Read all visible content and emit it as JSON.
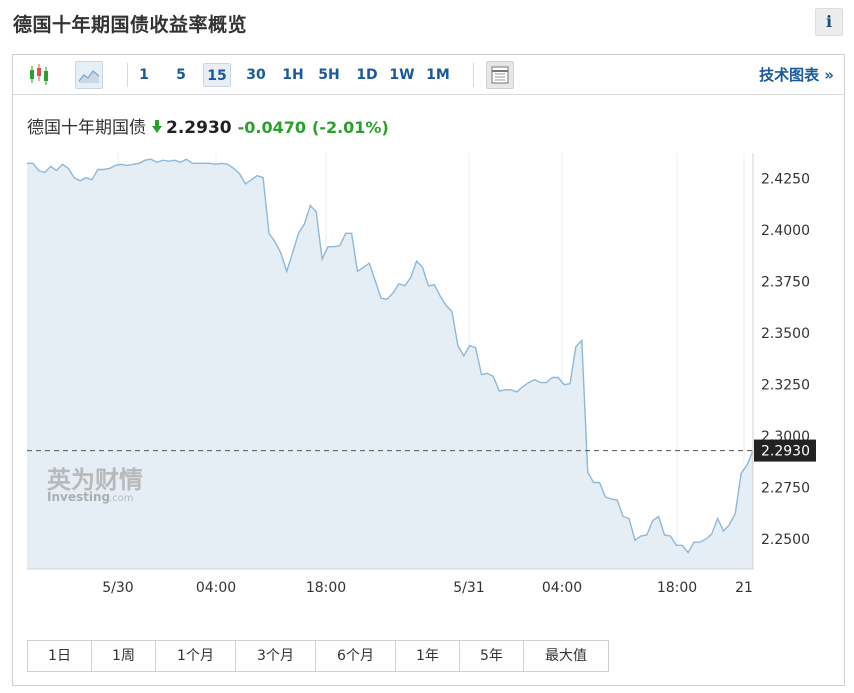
{
  "header": {
    "title": "德国十年期国债收益率概览",
    "info_label": "i"
  },
  "toolbar": {
    "intervals": [
      "1",
      "5",
      "15",
      "30",
      "1H",
      "5H",
      "1D",
      "1W",
      "1M"
    ],
    "active_interval": "15",
    "tech_link": "技术图表 »"
  },
  "quote": {
    "name": "德国十年期国债",
    "price": "2.2930",
    "change": "-0.0470",
    "change_pct": "(-2.01%)"
  },
  "watermark": {
    "cn": "英为财情",
    "en": "Investing",
    "suffix": ".com"
  },
  "ranges": [
    "1日",
    "1周",
    "1个月",
    "3个月",
    "6个月",
    "1年",
    "5年",
    "最大值"
  ],
  "colors": {
    "line": "#8fb8d8",
    "fill": "#e5eef5",
    "price_tag": "#222222",
    "change": "#2aa12a",
    "link": "#1a5a9c"
  },
  "chart_data": {
    "type": "area",
    "current_value": 2.293,
    "current_label": "2.2930",
    "ylim": [
      2.2355,
      2.4375
    ],
    "y_ticks": [
      2.425,
      2.4,
      2.375,
      2.35,
      2.325,
      2.3,
      2.275,
      2.25
    ],
    "y_tick_labels": [
      "2.4250",
      "2.4000",
      "2.3750",
      "2.3500",
      "2.3250",
      "2.3000",
      "2.2750",
      "2.2500"
    ],
    "x_tick_labels": [
      "5/30",
      "04:00",
      "18:00",
      "5/31",
      "04:00",
      "18:00",
      "21"
    ],
    "grid_labels_index": [
      0,
      1,
      2,
      3,
      4,
      5,
      6
    ],
    "values": [
      2.4325,
      2.4325,
      2.429,
      2.428,
      2.431,
      2.429,
      2.432,
      2.43,
      2.4255,
      2.424,
      2.4255,
      2.4245,
      2.4295,
      2.4295,
      2.43,
      2.4315,
      2.432,
      2.4315,
      2.432,
      2.4325,
      2.434,
      2.4345,
      2.433,
      2.434,
      2.4335,
      2.434,
      2.433,
      2.4345,
      2.4325,
      2.4325,
      2.4325,
      2.4325,
      2.432,
      2.4325,
      2.432,
      2.43,
      2.4275,
      2.4225,
      2.4245,
      2.4265,
      2.4255,
      2.3985,
      2.3945,
      2.389,
      2.38,
      2.389,
      2.3985,
      2.403,
      2.412,
      2.409,
      2.386,
      2.392,
      2.392,
      2.3925,
      2.3985,
      2.3985,
      2.38,
      2.382,
      2.384,
      2.3755,
      2.367,
      2.3665,
      2.3695,
      2.374,
      2.373,
      2.377,
      2.385,
      2.382,
      2.373,
      2.3735,
      2.368,
      2.3635,
      2.3605,
      2.344,
      2.339,
      2.344,
      2.343,
      2.33,
      2.3305,
      2.329,
      2.322,
      2.3225,
      2.3225,
      2.3215,
      2.324,
      2.326,
      2.3275,
      2.326,
      2.326,
      2.3285,
      2.3285,
      2.325,
      2.3255,
      2.3435,
      2.3465,
      2.2825,
      2.2775,
      2.2775,
      2.2705,
      2.2695,
      2.269,
      2.261,
      2.26,
      2.2495,
      2.2515,
      2.252,
      2.259,
      2.261,
      2.252,
      2.2515,
      2.247,
      2.247,
      2.2435,
      2.2485,
      2.2485,
      2.25,
      2.2525,
      2.26,
      2.254,
      2.257,
      2.2625,
      2.282,
      2.286,
      2.293
    ]
  }
}
